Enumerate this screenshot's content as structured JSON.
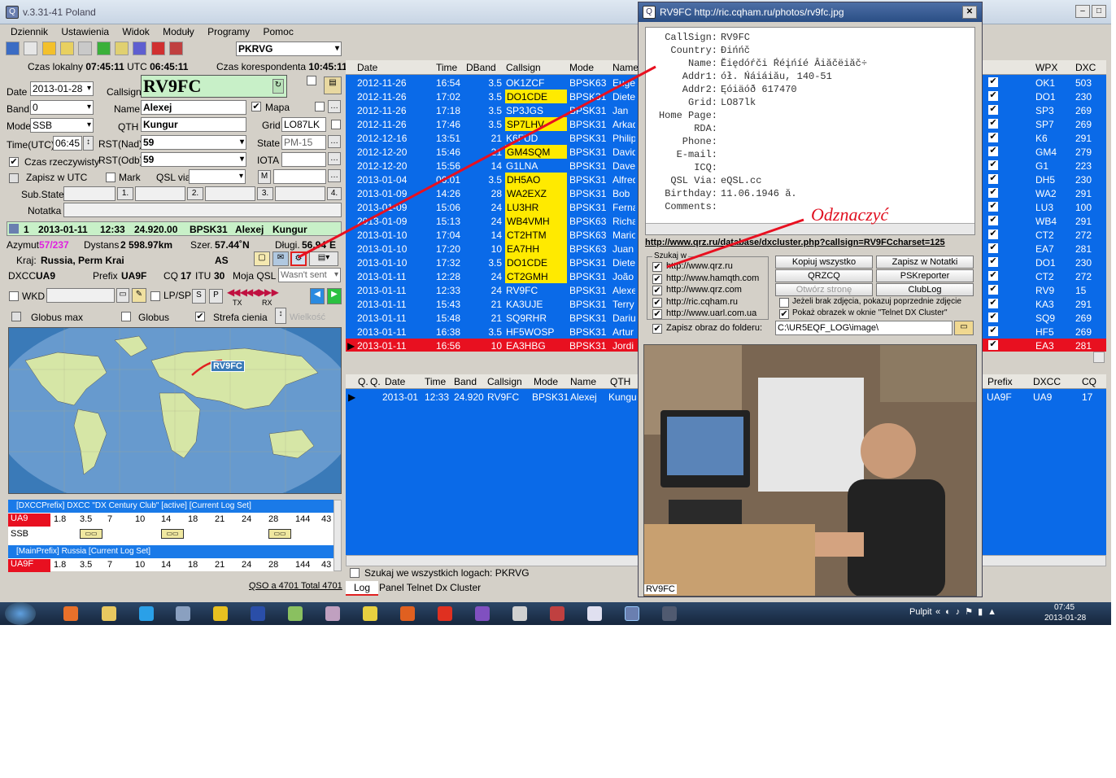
{
  "window": {
    "title": "v.3.31-41 Poland"
  },
  "menu": [
    "Dziennik",
    "Ustawienia",
    "Widok",
    "Moduły",
    "Programy",
    "Pomoc"
  ],
  "toolbar": {
    "station": "PKRVG"
  },
  "times": {
    "local_label": "Czas lokalny",
    "local": "07:45:11",
    "utc_label": "UTC",
    "utc": "06:45:11",
    "corr_label": "Czas korespondenta",
    "corr": "10:45:11"
  },
  "form": {
    "date_label": "Date",
    "date": "2013-01-28",
    "callsign_label": "Callsign",
    "callsign": "RV9FC",
    "band_label": "Band",
    "band": "0",
    "name_label": "Name",
    "name": "Alexej",
    "map_label": "Mapa",
    "mode_label": "Mode",
    "mode": "SSB",
    "qth_label": "QTH",
    "qth": "Kungur",
    "grid_label": "Grid",
    "grid": "LO87LK",
    "time_label": "Time(UTC)",
    "time": "06:45",
    "rstnad_label": "RST(Nad)",
    "rstnad": "59",
    "state_label": "State",
    "state": "PM-15",
    "real_time_label": "Czas rzeczywisty",
    "rstodb_label": "RST(Odb)",
    "rstodb": "59",
    "iota_label": "IOTA",
    "save_utc_label": "Zapisz w UTC",
    "mark_label": "Mark",
    "qslvia_label": "QSL via",
    "m_btn": "M",
    "substate_label": "Sub.State:",
    "b1": "1.",
    "b2": "2.",
    "b3": "3.",
    "b4": "4.",
    "note_label": "Notatka"
  },
  "lastqso": {
    "n": "1",
    "date": "2013-01-11",
    "time": "12:33",
    "freq": "24.920.00",
    "mode": "BPSK31",
    "name": "Alexej",
    "qth": "Kungur"
  },
  "stats": {
    "azimuth_label": "Azymut",
    "azimuth": "57/237",
    "distance_label": "Dystans",
    "distance": "2 598.97km",
    "lat_label": "Szer.",
    "lat": "57.44˚N",
    "lon_label": "Długi.",
    "lon": "56.94˚E",
    "country_label": "Kraj:",
    "country": "Russia, Perm Krai",
    "continent": "AS",
    "dxcc_label": "DXCC",
    "dxcc": "UA9",
    "prefix_label": "Prefix",
    "prefix": "UA9F",
    "cq_label": "CQ",
    "cq": "17",
    "itu_label": "ITU",
    "itu": "30",
    "myqsl_label": "Moja QSL",
    "myqsl": "Wasn't sent"
  },
  "wkd": {
    "wkd_label": "WKD",
    "lpsp_label": "LP/SP",
    "s": "S",
    "p": "P",
    "tx": "TX",
    "rx": "RX"
  },
  "globe": {
    "globus_max": "Globus max",
    "globus": "Globus",
    "shadow": "Strefa cienia",
    "size": "Wielkość",
    "map_label": "RV9FC"
  },
  "dxcc_panel": {
    "title": "[DXCCPrefix] DXCC \"DX Century Club\" [active] [Current Log Set]",
    "prefix": "UA9",
    "bands": [
      "1.8",
      "3.5",
      "7",
      "10",
      "14",
      "18",
      "21",
      "24",
      "28",
      "144",
      "43"
    ],
    "mode": "SSB"
  },
  "main_panel": {
    "title": "[MainPrefix] Russia [Current Log Set]",
    "prefix": "UA9F",
    "bands": [
      "1.8",
      "3.5",
      "7",
      "10",
      "14",
      "18",
      "21",
      "24",
      "28",
      "144",
      "43"
    ]
  },
  "status": {
    "qso": "QSO a 4701 Total 4701"
  },
  "log": {
    "headers": [
      "Date",
      "Time",
      "DBand",
      "Callsign",
      "Mode",
      "Name"
    ],
    "right_headers": [
      "WPX",
      "DXC"
    ],
    "rows": [
      [
        "2012-11-26",
        "16:54",
        "3.5",
        "OK1ZCF",
        "BPSK63",
        "Eugen",
        "OK1",
        "503"
      ],
      [
        "2012-11-26",
        "17:02",
        "3.5",
        "DO1CDE",
        "BPSK31",
        "Diete",
        "DO1",
        "230"
      ],
      [
        "2012-11-26",
        "17:18",
        "3.5",
        "SP3JGS",
        "BPSK31",
        "Jan",
        "SP3",
        "269"
      ],
      [
        "2012-11-26",
        "17:46",
        "3.5",
        "SP7LHV",
        "BPSK31",
        "Arkad",
        "SP7",
        "269"
      ],
      [
        "2012-12-16",
        "13:51",
        "21",
        "K6FUD",
        "BPSK31",
        "Philip",
        "K6",
        "291"
      ],
      [
        "2012-12-20",
        "15:46",
        "21",
        "GM4SQM",
        "BPSK31",
        "David",
        "GM4",
        "279"
      ],
      [
        "2012-12-20",
        "15:56",
        "14",
        "G1LNA",
        "BPSK31",
        "Dave",
        "G1",
        "223"
      ],
      [
        "2013-01-04",
        "06:01",
        "3.5",
        "DH5AO",
        "BPSK31",
        "Alfred",
        "DH5",
        "230"
      ],
      [
        "2013-01-09",
        "14:26",
        "28",
        "WA2EXZ",
        "BPSK31",
        "Bob",
        "WA2",
        "291"
      ],
      [
        "2013-01-09",
        "15:06",
        "24",
        "LU3HR",
        "BPSK31",
        "Ferna",
        "LU3",
        "100"
      ],
      [
        "2013-01-09",
        "15:13",
        "24",
        "WB4VMH",
        "BPSK63",
        "Richa",
        "WB4",
        "291"
      ],
      [
        "2013-01-10",
        "17:04",
        "14",
        "CT2HTM",
        "BPSK63",
        "Mario",
        "CT2",
        "272"
      ],
      [
        "2013-01-10",
        "17:20",
        "10",
        "EA7HH",
        "BPSK63",
        "Juan",
        "EA7",
        "281"
      ],
      [
        "2013-01-10",
        "17:32",
        "3.5",
        "DO1CDE",
        "BPSK31",
        "Diete",
        "DO1",
        "230"
      ],
      [
        "2013-01-11",
        "12:28",
        "24",
        "CT2GMH",
        "BPSK31",
        "João",
        "CT2",
        "272"
      ],
      [
        "2013-01-11",
        "12:33",
        "24",
        "RV9FC",
        "BPSK31",
        "Alexe",
        "RV9",
        "15"
      ],
      [
        "2013-01-11",
        "15:43",
        "21",
        "KA3UJE",
        "BPSK31",
        "Terry",
        "KA3",
        "291"
      ],
      [
        "2013-01-11",
        "15:48",
        "21",
        "SQ9RHR",
        "BPSK31",
        "Dariu",
        "SQ9",
        "269"
      ],
      [
        "2013-01-11",
        "16:38",
        "3.5",
        "HF5WOSP",
        "BPSK31",
        "Artur",
        "HF5",
        "269"
      ],
      [
        "2013-01-11",
        "16:56",
        "10",
        "EA3HBG",
        "BPSK31",
        "Jordi",
        "EA3",
        "281"
      ]
    ],
    "yellow_rows": [
      1,
      3,
      5,
      7,
      8,
      9,
      10,
      11,
      12,
      13,
      14
    ]
  },
  "sub": {
    "headers": [
      "Q.",
      "Q.",
      "Date",
      "Time",
      "Band",
      "Callsign",
      "Mode",
      "Name",
      "QTH"
    ],
    "right_headers": [
      "Prefix",
      "DXCC",
      "CQ"
    ],
    "row": [
      "2013-01",
      "12:33",
      "24.920",
      "RV9FC",
      "BPSK31",
      "Alexej",
      "Kungu"
    ],
    "right_row": [
      "UA9F",
      "UA9",
      "17"
    ]
  },
  "search_all": "Szukaj we wszystkich logach: PKRVG",
  "tabs": [
    "Log",
    "Panel Telnet Dx Cluster"
  ],
  "popup": {
    "title": "RV9FC http://ric.cqham.ru/photos/rv9fc.jpg",
    "info": [
      [
        "CallSign:",
        "RV9FC"
      ],
      [
        "Country:",
        "Đińńč"
      ],
      [
        "Name:",
        "Ĕiędóŕči Ŕéįńíé Âiăčëiăč÷"
      ],
      [
        "Addr1:",
        "ół. Ńáiáiău, 140-51"
      ],
      [
        "Addr2:",
        "Ęóiäóð 617470"
      ],
      [
        "Grid:",
        "LO87lk"
      ],
      [
        "Home Page:",
        ""
      ],
      [
        "RDA:",
        ""
      ],
      [
        "Phone:",
        ""
      ],
      [
        "E-mail:",
        ""
      ],
      [
        "ICQ:",
        ""
      ],
      [
        "QSL Via:",
        "eQSL.cc"
      ],
      [
        "Birthday:",
        "11.06.1946 ă."
      ],
      [
        "Comments:",
        ""
      ]
    ],
    "annotation": "Odznaczyć",
    "url": "http://www.qrz.ru/database/dxcluster.php?callsign=RV9FCcharset=125",
    "search_title": "Szukaj w",
    "sites": [
      "http://www.qrz.ru",
      "http://www.hamqth.com",
      "http://www.qrz.com",
      "http://ric.cqham.ru",
      "http://www.uarl.com.ua"
    ],
    "buttons": [
      "Kopiuj wszystko",
      "Zapisz w Notatki",
      "QRZCQ",
      "PSKreporter",
      "Otwórz stronę",
      "ClubLog"
    ],
    "opt1": "Jeżeli brak zdjęcia, pokazuj poprzednie zdjęcie",
    "opt2": "Pokaż obrazek w oknie \"Telnet DX Cluster\"",
    "save_label": "Zapisz obraz do folderu:",
    "folder": "C:\\UR5EQF_LOG\\image\\",
    "photo_label": "RV9FC"
  },
  "taskbar": {
    "pulpit": "Pulpit",
    "time": "07:45",
    "date": "2013-01-28"
  }
}
